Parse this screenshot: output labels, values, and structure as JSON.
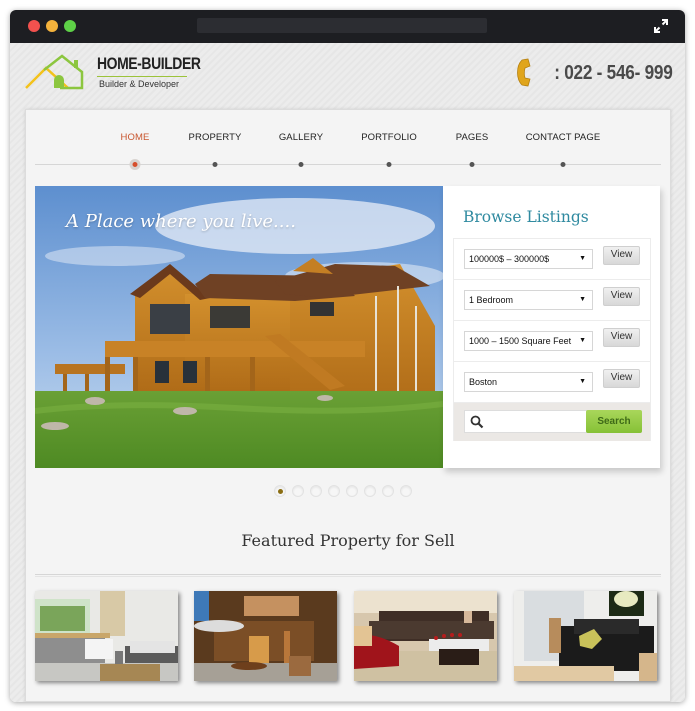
{
  "window": {
    "controls": [
      "close",
      "minimize",
      "maximize"
    ],
    "expand_icon": "expand-arrows-icon"
  },
  "header": {
    "brand_name": "HOME-BUILDER",
    "brand_tagline": "Builder & Developer",
    "logo_icon": "house-icon",
    "phone_icon": "phone-handset-icon",
    "phone_number": ": 022 - 546- 999"
  },
  "nav": {
    "items": [
      {
        "label": "HOME",
        "active": true
      },
      {
        "label": "PROPERTY",
        "active": false
      },
      {
        "label": "GALLERY",
        "active": false
      },
      {
        "label": "PORTFOLIO",
        "active": false
      },
      {
        "label": "PAGES",
        "active": false
      },
      {
        "label": "CONTACT PAGE",
        "active": false
      }
    ]
  },
  "slider": {
    "caption": "A Place where you live....",
    "image": "wooden-lodge-house-on-lawn",
    "slide_count": 8,
    "active_slide": 1
  },
  "browse": {
    "title": "Browse Listings",
    "filters": [
      {
        "name": "price",
        "value": "100000$ – 300000$",
        "button": "View"
      },
      {
        "name": "bedrooms",
        "value": "1 Bedroom",
        "button": "View"
      },
      {
        "name": "area",
        "value": "1000 – 1500 Square Feet",
        "button": "View"
      },
      {
        "name": "location",
        "value": "Boston",
        "button": "View"
      }
    ],
    "search": {
      "value": "",
      "placeholder": "",
      "button": "Search"
    }
  },
  "featured": {
    "title": "Featured Property for Sell",
    "thumbnails": [
      {
        "name": "modern-living-room-white"
      },
      {
        "name": "wooden-chalet-terrace"
      },
      {
        "name": "living-room-red-armchair"
      },
      {
        "name": "black-leather-sofa-room"
      }
    ]
  },
  "colors": {
    "nav_active": "#c8562f",
    "browse_title": "#2f8aa0",
    "search_button": "#86c136",
    "logo_green": "#8cc63f",
    "logo_yellow": "#f3c21b",
    "phone_gold": "#e0a51c"
  }
}
